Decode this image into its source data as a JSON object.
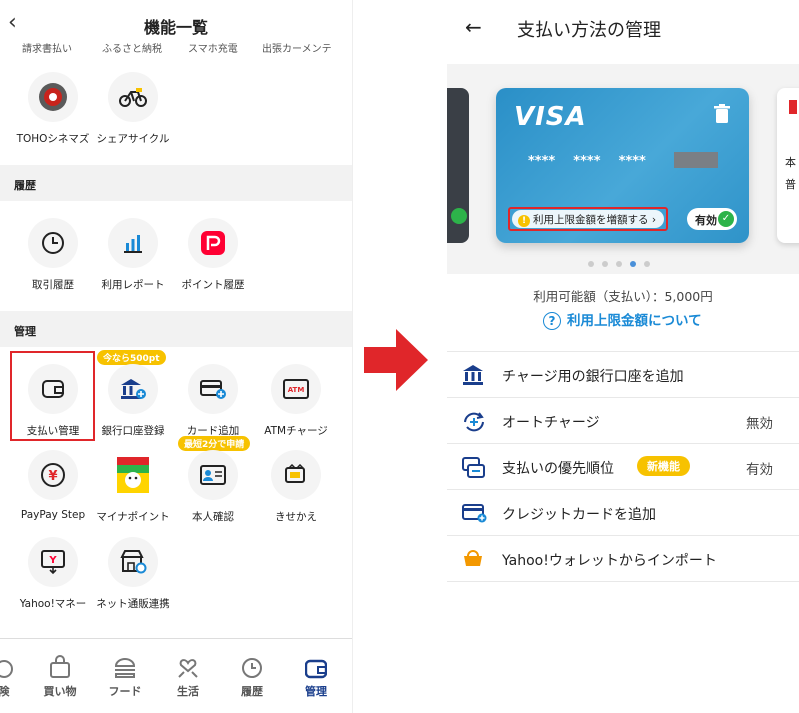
{
  "left": {
    "title": "機能一覧",
    "cut_labels": [
      "請求書払い",
      "ふるさと納税",
      "スマホ充電",
      "出張カーメンテ"
    ],
    "top_items": [
      {
        "label": "TOHOシネマズ",
        "icon": "toho-icon"
      },
      {
        "label": "シェアサイクル",
        "icon": "bicycle-icon"
      }
    ],
    "history": {
      "header": "履歴",
      "items": [
        {
          "label": "取引履歴",
          "icon": "clock-icon"
        },
        {
          "label": "利用レポート",
          "icon": "bar-chart-icon"
        },
        {
          "label": "ポイント履歴",
          "icon": "paypay-icon"
        }
      ]
    },
    "manage": {
      "header": "管理",
      "items": [
        {
          "label": "支払い管理",
          "icon": "wallet-icon"
        },
        {
          "label": "銀行口座登録",
          "icon": "bank-add-icon",
          "badge": "今なら500pt"
        },
        {
          "label": "カード追加",
          "icon": "card-add-icon"
        },
        {
          "label": "ATMチャージ",
          "icon": "atm-icon"
        },
        {
          "label": "PayPay Step",
          "icon": "yen-medal-icon"
        },
        {
          "label": "マイナポイント",
          "icon": "mynapoint-icon"
        },
        {
          "label": "本人確認",
          "icon": "id-card-icon",
          "badge": "最短2分で申請"
        },
        {
          "label": "きせかえ",
          "icon": "theme-icon"
        },
        {
          "label": "Yahoo!マネー",
          "icon": "yahoo-money-icon"
        },
        {
          "label": "ネット通販連携",
          "icon": "shop-link-icon"
        }
      ]
    },
    "tabs": [
      {
        "label": "険",
        "icon": "partial-icon"
      },
      {
        "label": "買い物",
        "icon": "bag-icon"
      },
      {
        "label": "フード",
        "icon": "burger-icon"
      },
      {
        "label": "生活",
        "icon": "life-icon"
      },
      {
        "label": "履歴",
        "icon": "clock-icon"
      },
      {
        "label": "管理",
        "icon": "wallet-icon",
        "active": true
      }
    ]
  },
  "right": {
    "title": "支払い方法の管理",
    "card": {
      "brand": "VISA",
      "number": "****    ****    ****",
      "increase_limit_label": "利用上限金額を増額する ›",
      "status": "有効"
    },
    "available_amount": "利用可能額（支払い）：5,000円",
    "limit_help_link": "利用上限金額について",
    "peek_right_text": [
      "本",
      "普"
    ],
    "menu": [
      {
        "label": "チャージ用の銀行口座を追加",
        "icon": "bank-icon",
        "value": ""
      },
      {
        "label": "オートチャージ",
        "icon": "auto-charge-icon",
        "value": "無効"
      },
      {
        "label": "支払いの優先順位",
        "icon": "priority-icon",
        "value": "有効",
        "badge": "新機能"
      },
      {
        "label": "クレジットカードを追加",
        "icon": "credit-card-icon",
        "value": ""
      },
      {
        "label": "Yahoo!ウォレットからインポート",
        "icon": "wallet-purse-icon",
        "value": ""
      }
    ]
  },
  "colors": {
    "accent": "#e0262a",
    "paypay_red": "#ff0033",
    "link_blue": "#1a8ad6",
    "badge_yellow": "#f7c200",
    "green": "#2db34a"
  }
}
